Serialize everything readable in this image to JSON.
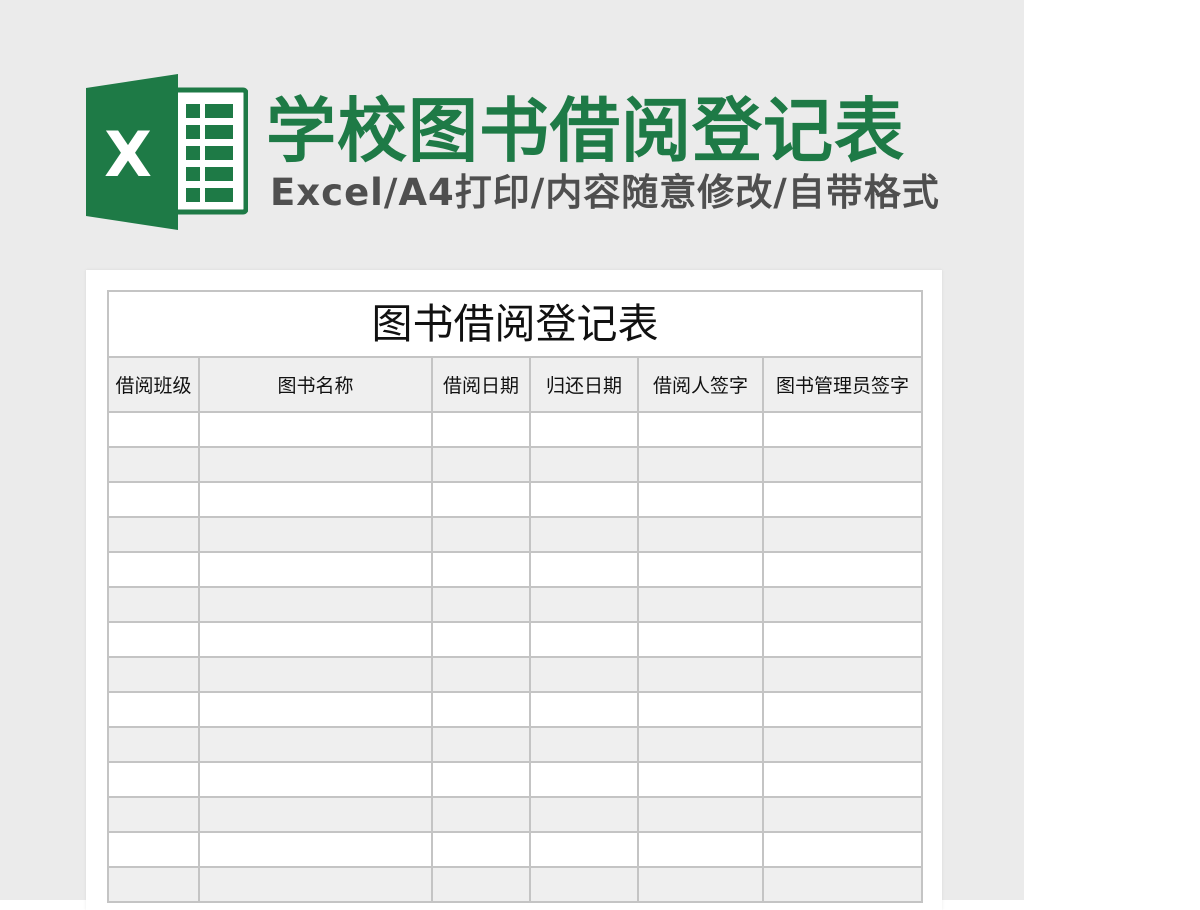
{
  "banner": {
    "logo_letter": "X",
    "title": "学校图书借阅登记表",
    "subtitle": "Excel/A4打印/内容随意修改/自带格式",
    "title_color": "#1e7a46",
    "logo_color": "#1e7a46",
    "subtitle_color": "#4f4f4f",
    "logo_icon": "excel-icon"
  },
  "ledger": {
    "title": "图书借阅登记表",
    "columns": [
      "借阅班级",
      "图书名称",
      "借阅日期",
      "归还日期",
      "借阅人签字",
      "图书管理员签字"
    ],
    "empty_row_count": 14,
    "row_colors": [
      "#ffffff",
      "#efefef"
    ],
    "border_color": "#c4c4c4"
  }
}
